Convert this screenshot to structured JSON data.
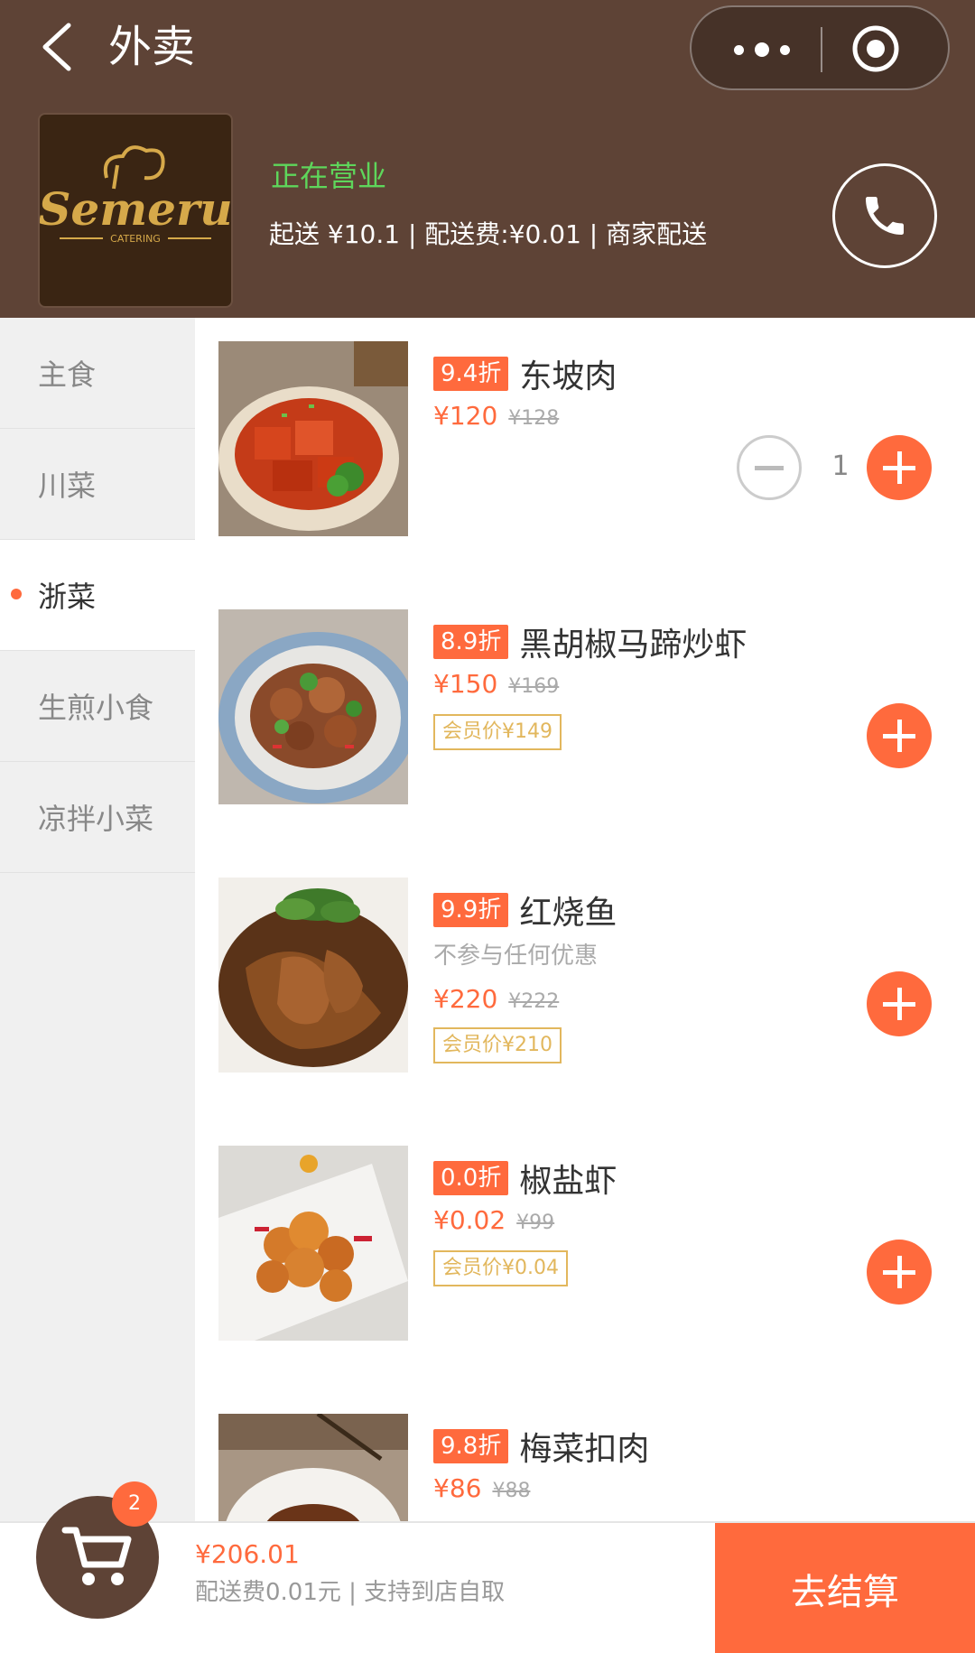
{
  "header": {
    "title": "外卖",
    "store_status": "正在营业",
    "delivery_info": "起送 ¥10.1 | 配送费:¥0.01 | 商家配送",
    "logo_text": "Semeru",
    "logo_subtext": "CATERING"
  },
  "categories": [
    {
      "label": "主食",
      "active": false
    },
    {
      "label": "川菜",
      "active": false
    },
    {
      "label": "浙菜",
      "active": true
    },
    {
      "label": "生煎小食",
      "active": false
    },
    {
      "label": "凉拌小菜",
      "active": false
    }
  ],
  "dishes": [
    {
      "discount": "9.4折",
      "name": "东坡肉",
      "note": "",
      "price": "¥120",
      "old_price": "¥128",
      "member_price": "",
      "quantity": "1"
    },
    {
      "discount": "8.9折",
      "name": "黑胡椒马蹄炒虾",
      "note": "",
      "price": "¥150",
      "old_price": "¥169",
      "member_price": "会员价¥149",
      "quantity": ""
    },
    {
      "discount": "9.9折",
      "name": "红烧鱼",
      "note": "不参与任何优惠",
      "price": "¥220",
      "old_price": "¥222",
      "member_price": "会员价¥210",
      "quantity": ""
    },
    {
      "discount": "0.0折",
      "name": "椒盐虾",
      "note": "",
      "price": "¥0.02",
      "old_price": "¥99",
      "member_price": "会员价¥0.04",
      "quantity": ""
    },
    {
      "discount": "9.8折",
      "name": "梅菜扣肉",
      "note": "",
      "price": "¥86",
      "old_price": "¥88",
      "member_price": "",
      "quantity": ""
    }
  ],
  "cart": {
    "count": "2",
    "total": "¥206.01",
    "fee_note": "配送费0.01元 | 支持到店自取",
    "checkout_label": "去结算"
  },
  "colors": {
    "header_bg": "#5e4336",
    "accent": "#ff6a3d",
    "status_green": "#5ed65b",
    "member_gold": "#e2b75d"
  }
}
